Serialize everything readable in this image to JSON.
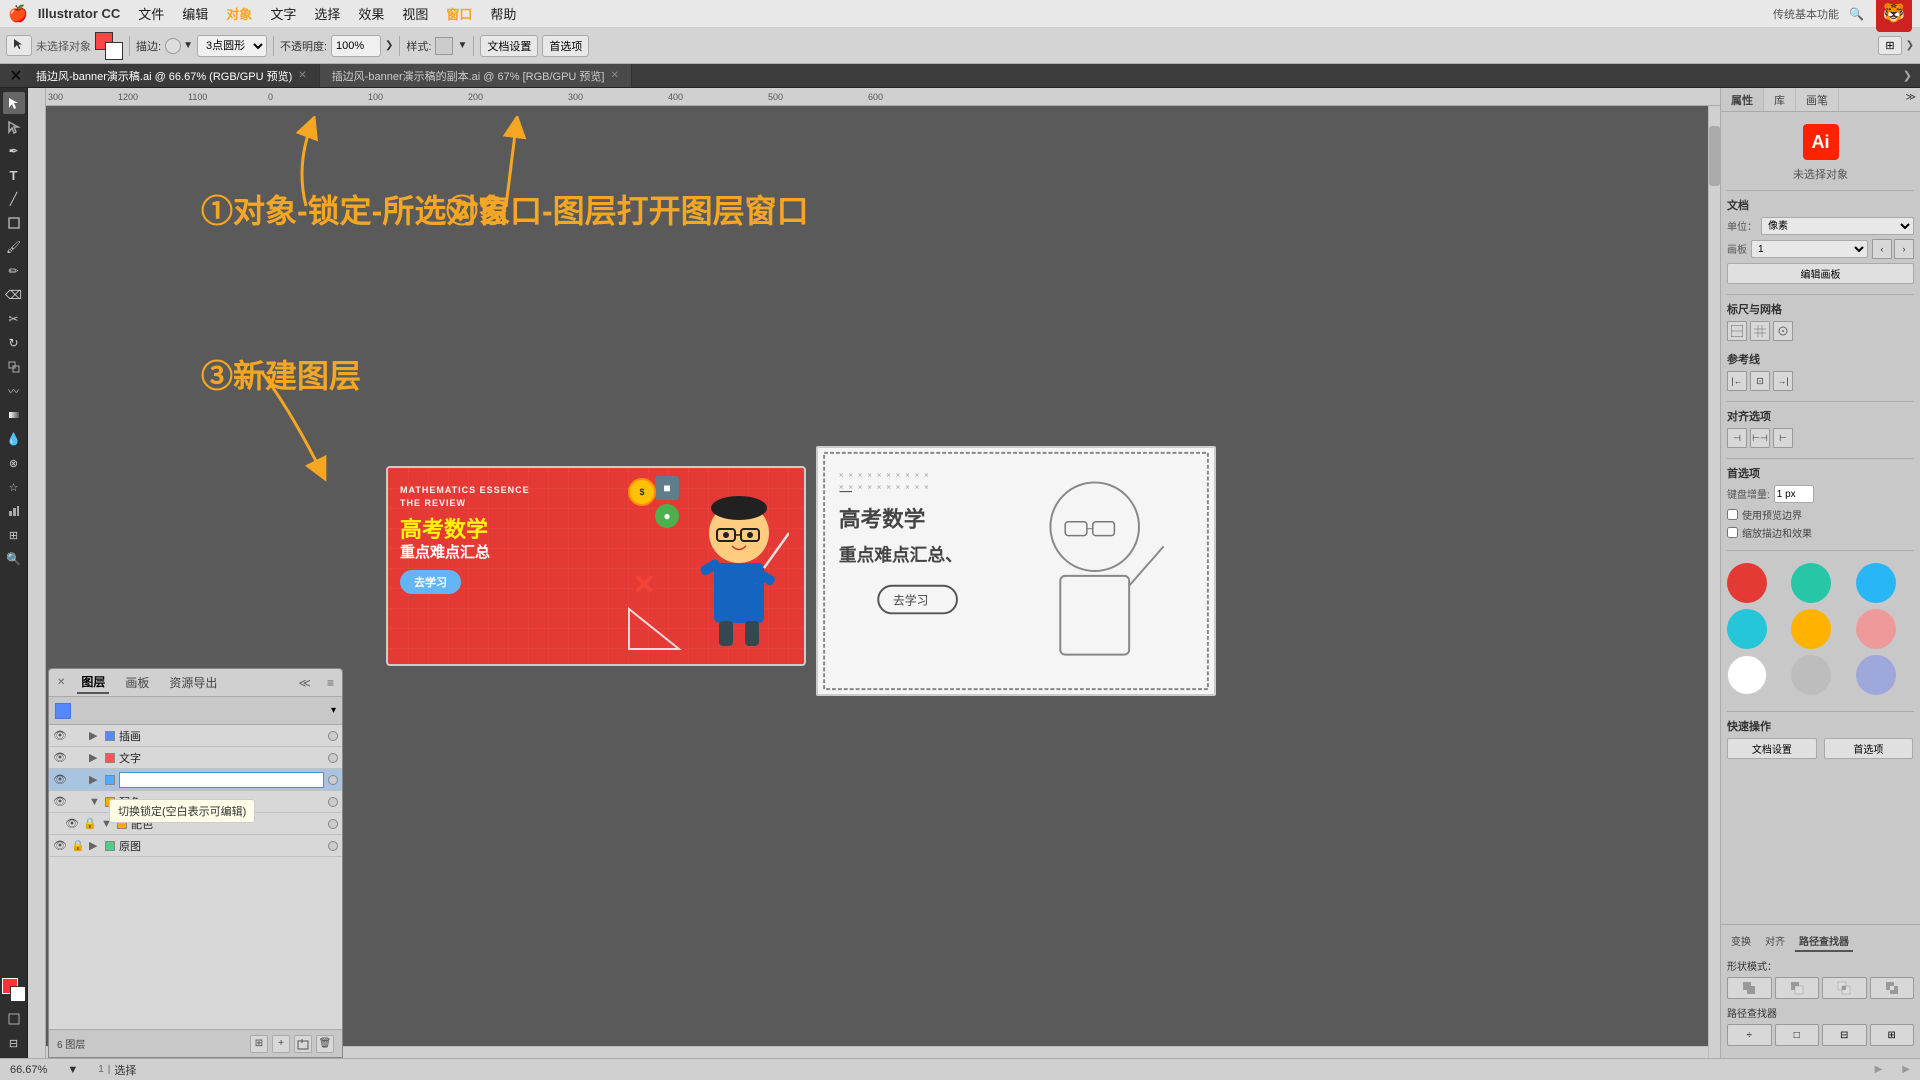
{
  "app": {
    "name": "Illustrator CC",
    "logo": "Ai"
  },
  "menubar": {
    "apple": "🍎",
    "items": [
      "Illustrator CC",
      "文件",
      "编辑",
      "对象",
      "文字",
      "选择",
      "效果",
      "视图",
      "窗口",
      "帮助"
    ]
  },
  "toolbar": {
    "no_selection": "未选择对象",
    "stroke_label": "描边:",
    "stroke_value": "3点圆形",
    "opacity_label": "不透明度:",
    "opacity_value": "100%",
    "style_label": "样式:",
    "doc_settings": "文档设置",
    "preferences": "首选项"
  },
  "tabs": [
    {
      "label": "插边风-banner演示稿.ai @ 66.67% (RGB/GPU 预览)",
      "active": true
    },
    {
      "label": "插边风-banner演示稿的副本.ai @ 67% [RGB/GPU 预览]",
      "active": false
    }
  ],
  "annotations": {
    "step1": "①对象-锁定-所选对象",
    "step2": "②窗口-图层打开图层窗口",
    "step3": "③新建图层"
  },
  "canvas": {
    "zoom": "66.67%",
    "mode": "选择",
    "page": "1"
  },
  "layers_panel": {
    "title": "图层",
    "tabs": [
      "图层",
      "画板",
      "资源导出"
    ],
    "layers": [
      {
        "name": "插画",
        "visible": true,
        "locked": false,
        "color": "#5588ff",
        "expanded": false
      },
      {
        "name": "文字",
        "visible": true,
        "locked": false,
        "color": "#ff5555",
        "expanded": false
      },
      {
        "name": "",
        "visible": true,
        "locked": false,
        "color": "#55aaff",
        "expanded": false,
        "active": true,
        "editing": true
      },
      {
        "name": "配色",
        "visible": true,
        "locked": false,
        "color": "#ffaa00",
        "expanded": true
      },
      {
        "name": "配色",
        "visible": true,
        "locked": true,
        "color": "#ffaa00",
        "expanded": true
      },
      {
        "name": "原图",
        "visible": true,
        "locked": true,
        "color": "#55cc88",
        "expanded": false
      }
    ],
    "footer": "6 图层",
    "footer_buttons": [
      "新建图层",
      "删除",
      "上移",
      "下移"
    ]
  },
  "tooltip": {
    "text": "切换锁定(空白表示可编辑)"
  },
  "right_panel": {
    "tabs": [
      "属性",
      "库",
      "画笔"
    ],
    "active_tab": "属性",
    "no_selection": "未选择对象",
    "document_section": "文档",
    "units_label": "单位：",
    "units_value": "像素",
    "artboard_label": "画板",
    "artboard_value": "1",
    "edit_artboard_btn": "编辑画板",
    "rulers_grids": "标尺与网格",
    "guides": "参考线",
    "align": "对齐选项",
    "preferences": "首选项",
    "keyboard_increment_label": "键盘增量:",
    "keyboard_increment_value": "1 px",
    "scale_strokes_label": "使用预览边界",
    "align_to_pixel": "缩放描边和效果",
    "quick_actions_label": "快速操作",
    "doc_settings_btn": "文档设置",
    "preferences_btn": "首选项",
    "swatches": [
      {
        "color": "#e53935",
        "name": "red"
      },
      {
        "color": "#26c6a6",
        "name": "teal"
      },
      {
        "color": "#29b6f6",
        "name": "blue"
      },
      {
        "color": "#26c6da",
        "name": "cyan"
      },
      {
        "color": "#ffb300",
        "name": "amber"
      },
      {
        "color": "#ef9a9a",
        "name": "pink"
      },
      {
        "color": "#ffffff",
        "name": "white"
      },
      {
        "color": "#bdbdbd",
        "name": "gray"
      },
      {
        "color": "#9fa8da",
        "name": "indigo-light"
      }
    ]
  },
  "bottom_panel": {
    "tabs": [
      "变换",
      "对齐",
      "路径查找器"
    ],
    "active_tab": "路径查找器",
    "shape_modes_label": "形状模式：",
    "path_finder_label": "路径查找器"
  },
  "banner_red": {
    "tag_line1": "MATHEMATICS ESSENCE",
    "tag_line2": "THE REVIEW",
    "title": "高考数学",
    "subtitle": "重点难点汇总",
    "button": "去学习"
  },
  "status_bar": {
    "zoom": "66.67%",
    "page": "1",
    "mode": "选择"
  }
}
